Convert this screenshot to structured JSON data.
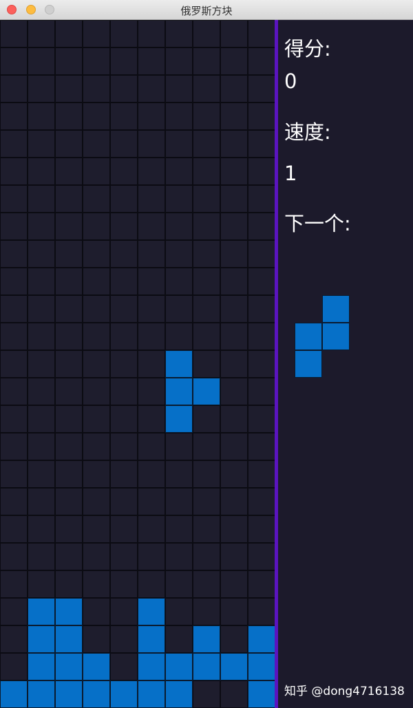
{
  "window": {
    "title": "俄罗斯方块"
  },
  "panel": {
    "score_label": "得分:",
    "score_value": "0",
    "speed_label": "速度:",
    "speed_value": "1",
    "next_label": "下一个:"
  },
  "colors": {
    "background": "#1c1a2b",
    "block": "#0670c8",
    "divider": "#5a14bf",
    "grid_line": "#0b0b12"
  },
  "board": {
    "columns": 10,
    "rows": 25,
    "filled_cells": [
      [
        6,
        12
      ],
      [
        6,
        13
      ],
      [
        7,
        13
      ],
      [
        6,
        14
      ],
      [
        1,
        21
      ],
      [
        2,
        21
      ],
      [
        5,
        21
      ],
      [
        1,
        22
      ],
      [
        2,
        22
      ],
      [
        5,
        22
      ],
      [
        7,
        22
      ],
      [
        9,
        22
      ],
      [
        1,
        23
      ],
      [
        2,
        23
      ],
      [
        3,
        23
      ],
      [
        5,
        23
      ],
      [
        6,
        23
      ],
      [
        7,
        23
      ],
      [
        8,
        23
      ],
      [
        9,
        23
      ],
      [
        0,
        24
      ],
      [
        1,
        24
      ],
      [
        2,
        24
      ],
      [
        3,
        24
      ],
      [
        4,
        24
      ],
      [
        5,
        24
      ],
      [
        6,
        24
      ],
      [
        9,
        24
      ]
    ]
  },
  "next_piece": {
    "cells": [
      [
        1,
        0
      ],
      [
        0,
        1
      ],
      [
        1,
        1
      ],
      [
        0,
        2
      ]
    ]
  },
  "watermark": "知乎 @dong4716138"
}
